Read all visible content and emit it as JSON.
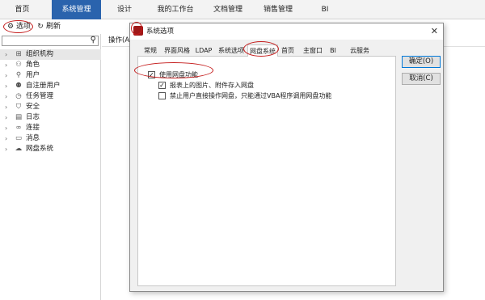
{
  "topnav": {
    "tabs": [
      {
        "label": "首页"
      },
      {
        "label": "系统管理"
      },
      {
        "label": "设计"
      },
      {
        "label": "我的工作台"
      },
      {
        "label": "文档管理"
      },
      {
        "label": "销售管理"
      },
      {
        "label": "BI"
      }
    ]
  },
  "toolbar": {
    "options_label": "选项",
    "refresh_label": "刷新"
  },
  "tree": {
    "items": [
      {
        "label": "组织机构",
        "icon": "org-icon",
        "glyph": "⊞"
      },
      {
        "label": "角色",
        "icon": "role-icon",
        "glyph": "⚇"
      },
      {
        "label": "用户",
        "icon": "user-icon",
        "glyph": "⚲"
      },
      {
        "label": "自注册用户",
        "icon": "self-register-user-icon",
        "glyph": "⚉"
      },
      {
        "label": "任务管理",
        "icon": "task-clock-icon",
        "glyph": "◷"
      },
      {
        "label": "安全",
        "icon": "shield-icon",
        "glyph": "⛉"
      },
      {
        "label": "日志",
        "icon": "log-icon",
        "glyph": "▤"
      },
      {
        "label": "连接",
        "icon": "link-icon",
        "glyph": "∞"
      },
      {
        "label": "消息",
        "icon": "message-icon",
        "glyph": "▭"
      },
      {
        "label": "网盘系统",
        "icon": "cloud-icon",
        "glyph": "☁"
      }
    ]
  },
  "right_header": {
    "label": "操作(A)"
  },
  "dialog": {
    "title": "系统选项",
    "close_glyph": "✕",
    "tabs": [
      {
        "label": "常规"
      },
      {
        "label": "界面风格"
      },
      {
        "label": "LDAP"
      },
      {
        "label": "系统选项"
      },
      {
        "label": "网盘系统"
      },
      {
        "label": "首页"
      },
      {
        "label": "主窗口"
      },
      {
        "label": "BI"
      },
      {
        "label": "云服务"
      }
    ],
    "options": [
      {
        "label": "使用网盘功能",
        "checked": true
      },
      {
        "label": "报表上的图片、附件存入网盘",
        "checked": true
      },
      {
        "label": "禁止用户直接操作网盘，只能通过VBA程序调用网盘功能",
        "checked": false
      }
    ],
    "ok_label": "确定(O)",
    "cancel_label": "取消(C)"
  },
  "colors": {
    "nav_active_bg": "#2a63ad",
    "annotation_red": "#c41a1a",
    "primary_button_border": "#0078d7"
  }
}
